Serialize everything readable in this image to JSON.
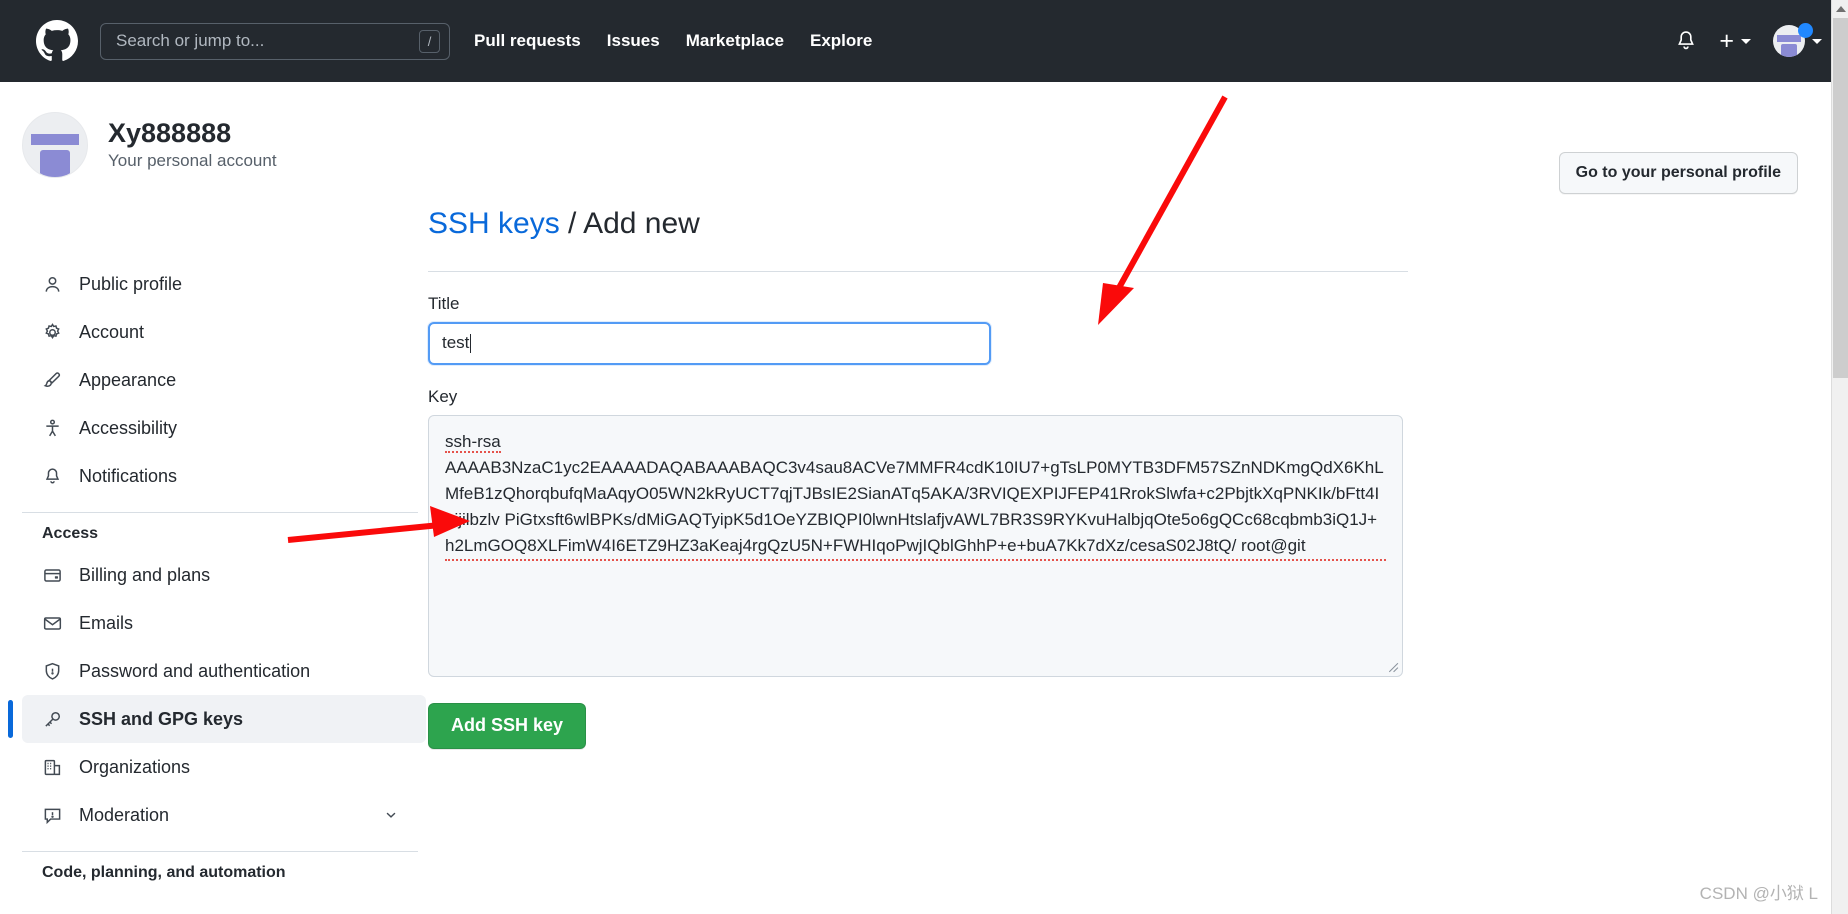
{
  "header": {
    "logo": "github-logo",
    "search": {
      "placeholder": "Search or jump to...",
      "shortcut": "/"
    },
    "nav": [
      {
        "label": "Pull requests"
      },
      {
        "label": "Issues"
      },
      {
        "label": "Marketplace"
      },
      {
        "label": "Explore"
      }
    ],
    "notifications_icon": "bell-icon",
    "create_new_icon": "plus-icon",
    "avatar_icon": "user-avatar"
  },
  "profile": {
    "name": "Xy888888",
    "subtitle": "Your personal account",
    "personal_profile_button": "Go to your personal profile"
  },
  "sidebar": {
    "primary": [
      {
        "label": "Public profile",
        "icon": "person-icon"
      },
      {
        "label": "Account",
        "icon": "gear-icon"
      },
      {
        "label": "Appearance",
        "icon": "paintbrush-icon"
      },
      {
        "label": "Accessibility",
        "icon": "accessibility-icon"
      },
      {
        "label": "Notifications",
        "icon": "bell-icon"
      }
    ],
    "access_group_title": "Access",
    "access": [
      {
        "label": "Billing and plans",
        "icon": "credit-card-icon"
      },
      {
        "label": "Emails",
        "icon": "mail-icon"
      },
      {
        "label": "Password and authentication",
        "icon": "shield-lock-icon"
      },
      {
        "label": "SSH and GPG keys",
        "icon": "key-icon",
        "active": true
      },
      {
        "label": "Organizations",
        "icon": "organization-icon"
      },
      {
        "label": "Moderation",
        "icon": "report-icon",
        "expandable": true
      }
    ],
    "code_group_title": "Code, planning, and automation"
  },
  "main": {
    "breadcrumb_link": "SSH keys",
    "breadcrumb_separator": "/",
    "breadcrumb_current": "Add new",
    "title_label": "Title",
    "title_value": "test",
    "key_label": "Key",
    "key_line1": "ssh-rsa",
    "key_value": "AAAAB3NzaC1yc2EAAAADAQABAAABAQC3v4sau8ACVe7MMFR4cdK10IU7+gTsLP0MYTB3DFM57SZnNDKmgQdX6KhLMfeB1zQhorqbufqMaAqyO05WN2kRyUCT7qjTJBsIE2SianATq5AKA/3RVIQEXPIJFEP41RrokSlwfa+c2PbjtkXqPNKIk/bFtt4Inijilbzlv PiGtxsft6wlBPKs/dMiGAQTyipK5d1OeYZBIQPI0lwnHtslafjvAWL7BR3S9RYKvuHalbjqOte5o6gQCc68cqbmb3iQ1J+h2LmGOQ8XLFimW4I6ETZ9HZ3aKeaj4rgQzU5N+FWHIqoPwjIQblGhhP+e+buA7Kk7dXz/cesaS02J8tQ/ root@git",
    "submit_label": "Add SSH key"
  },
  "watermark": "CSDN @小狱 L",
  "colors": {
    "header_bg": "#24292f",
    "link_blue": "#0969da",
    "accent_blue": "#539bf5",
    "green_button": "#2da44e",
    "annotation_red": "#fa0a0a",
    "avatar_purple": "#8b8bd4"
  }
}
